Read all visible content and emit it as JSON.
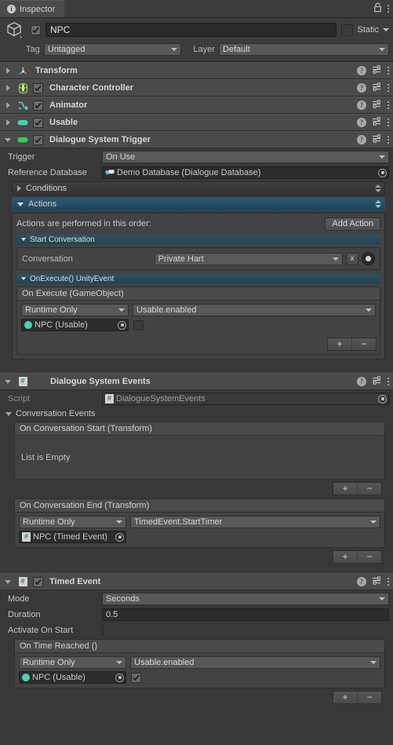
{
  "window": {
    "tab_label": "Inspector",
    "info_icon": "info-icon",
    "lock_icon": "lock-icon",
    "menu_icon": "kebab-menu-icon"
  },
  "object_header": {
    "icon": "cube-icon",
    "active_checkbox": true,
    "name": "NPC",
    "static_label": "Static",
    "static_checked": false,
    "tag_label": "Tag",
    "tag_value": "Untagged",
    "layer_label": "Layer",
    "layer_value": "Default"
  },
  "components": [
    {
      "name": "Transform",
      "icon": "transform-icon",
      "expanded": false,
      "has_enable_checkbox": false,
      "enabled": false
    },
    {
      "name": "Character Controller",
      "icon": "character-controller-icon",
      "expanded": false,
      "has_enable_checkbox": true,
      "enabled": true
    },
    {
      "name": "Animator",
      "icon": "animator-icon",
      "expanded": false,
      "has_enable_checkbox": true,
      "enabled": true
    },
    {
      "name": "Usable",
      "icon": "usable-script-icon",
      "expanded": false,
      "has_enable_checkbox": true,
      "enabled": true
    },
    {
      "name": "Dialogue System Trigger",
      "icon": "dialogue-trigger-icon",
      "expanded": true,
      "has_enable_checkbox": true,
      "enabled": true
    }
  ],
  "dialogue_system_trigger": {
    "trigger_label": "Trigger",
    "trigger_value": "On Use",
    "reference_db_label": "Reference Database",
    "reference_db_value": "Demo Database (Dialogue Database)",
    "conditions_label": "Conditions",
    "conditions_expanded": false,
    "actions_label": "Actions",
    "actions_expanded": true,
    "actions_hint": "Actions are performed in this order:",
    "add_action_label": "Add Action",
    "start_conversation": {
      "header": "Start Conversation",
      "conversation_label": "Conversation",
      "conversation_value": "Private Hart",
      "clear_label": "x",
      "pick_icon": "record-dot-button"
    },
    "on_execute": {
      "header": "OnExecute() UnityEvent",
      "list_title": "On Execute (GameObject)",
      "entries": [
        {
          "call_state": "Runtime Only",
          "method": "Usable.enabled",
          "target": "NPC (Usable)",
          "target_icon": "usable-component-icon",
          "bool_value": false
        }
      ],
      "add_label": "+",
      "remove_label": "−"
    }
  },
  "dialogue_system_events": {
    "component_name": "Dialogue System Events",
    "icon": "script-icon",
    "expanded": true,
    "script_label": "Script",
    "script_value": "DialogueSystemEvents",
    "conversation_events_label": "Conversation Events",
    "on_conversation_start": {
      "title": "On Conversation Start (Transform)",
      "empty_message": "List is Empty",
      "add_label": "+",
      "remove_label": "−"
    },
    "on_conversation_end": {
      "title": "On Conversation End (Transform)",
      "entries": [
        {
          "call_state": "Runtime Only",
          "method": "TimedEvent.StartTimer",
          "target": "NPC (Timed Event)",
          "target_icon": "script-icon"
        }
      ],
      "add_label": "+",
      "remove_label": "−"
    }
  },
  "timed_event": {
    "component_name": "Timed Event",
    "icon": "script-icon",
    "expanded": true,
    "enabled": true,
    "mode_label": "Mode",
    "mode_value": "Seconds",
    "duration_label": "Duration",
    "duration_value": "0.5",
    "activate_on_start_label": "Activate On Start",
    "activate_on_start_checked": false,
    "on_time_reached": {
      "title": "On Time Reached ()",
      "entries": [
        {
          "call_state": "Runtime Only",
          "method": "Usable.enabled",
          "target": "NPC (Usable)",
          "target_icon": "usable-component-icon",
          "bool_value": true
        }
      ],
      "add_label": "+",
      "remove_label": "−"
    }
  },
  "colors": {
    "panel_bg": "#383838",
    "header_bg": "#4a4a4a",
    "accent_teal": "#2c5a6e",
    "usable_green": "#4ad2b0",
    "script_green": "#2a7d4f"
  }
}
